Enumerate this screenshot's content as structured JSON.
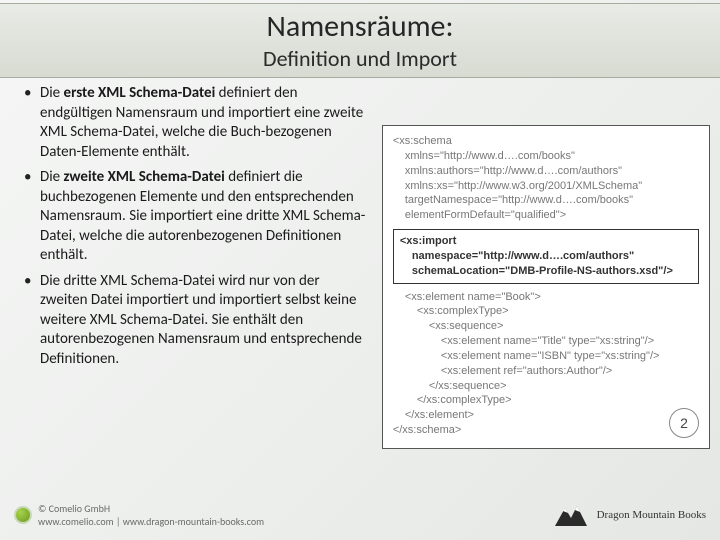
{
  "header": {
    "title": "Namensräume:",
    "subtitle": "Definition und Import"
  },
  "bullets": [
    {
      "pre": "Die ",
      "bold": "erste XML Schema-Datei",
      "post": " definiert den endgültigen Namensraum und importiert eine zweite XML Schema-Datei, welche die Buch-bezogenen Daten-Elemente enthält."
    },
    {
      "pre": "Die ",
      "bold": "zweite XML Schema-Datei",
      "post": " definiert die buchbezogenen Elemente und den entsprechenden Namensraum. Sie importiert eine dritte XML Schema-Datei, welche die autorenbezogenen Definitionen enthält."
    },
    {
      "pre": "Die dritte XML Schema-Datei wird nur von der zweiten Datei importiert und importiert selbst keine weitere XML Schema-Datei. Sie enthält den autorenbezogenen Namensraum und entsprechende Definitionen.",
      "bold": "",
      "post": ""
    }
  ],
  "code": {
    "l1": "<xs:schema",
    "l2": "xmlns=\"http://www.d….com/books\"",
    "l3": "xmlns:authors=\"http://www.d….com/authors\"",
    "l4": "xmlns:xs=\"http://www.w3.org/2001/XMLSchema\"",
    "l5": "targetNamespace=\"http://www.d….com/books\"",
    "l6": "elementFormDefault=\"qualified\">",
    "i1": "<xs:import",
    "i2": "namespace=\"http://www.d….com/authors\"",
    "i3": "schemaLocation=\"DMB-Profile-NS-authors.xsd\"/>",
    "l7": "<xs:element name=\"Book\">",
    "l8": "<xs:complexType>",
    "l9": "<xs:sequence>",
    "l10": "<xs:element name=\"Title\" type=\"xs:string\"/>",
    "l11": "<xs:element name=\"ISBN\" type=\"xs:string\"/>",
    "l12": "<xs:element ref=\"authors:Author\"/>",
    "l13": "</xs:sequence>",
    "l14": "</xs:complexType>",
    "l15": "</xs:element>",
    "l16": "</xs:schema>",
    "page": "2"
  },
  "footer": {
    "left_line1": "© Comelio GmbH",
    "left_line2": "www.comelio.com | www.dragon-mountain-books.com",
    "right": "Dragon Mountain Books"
  }
}
